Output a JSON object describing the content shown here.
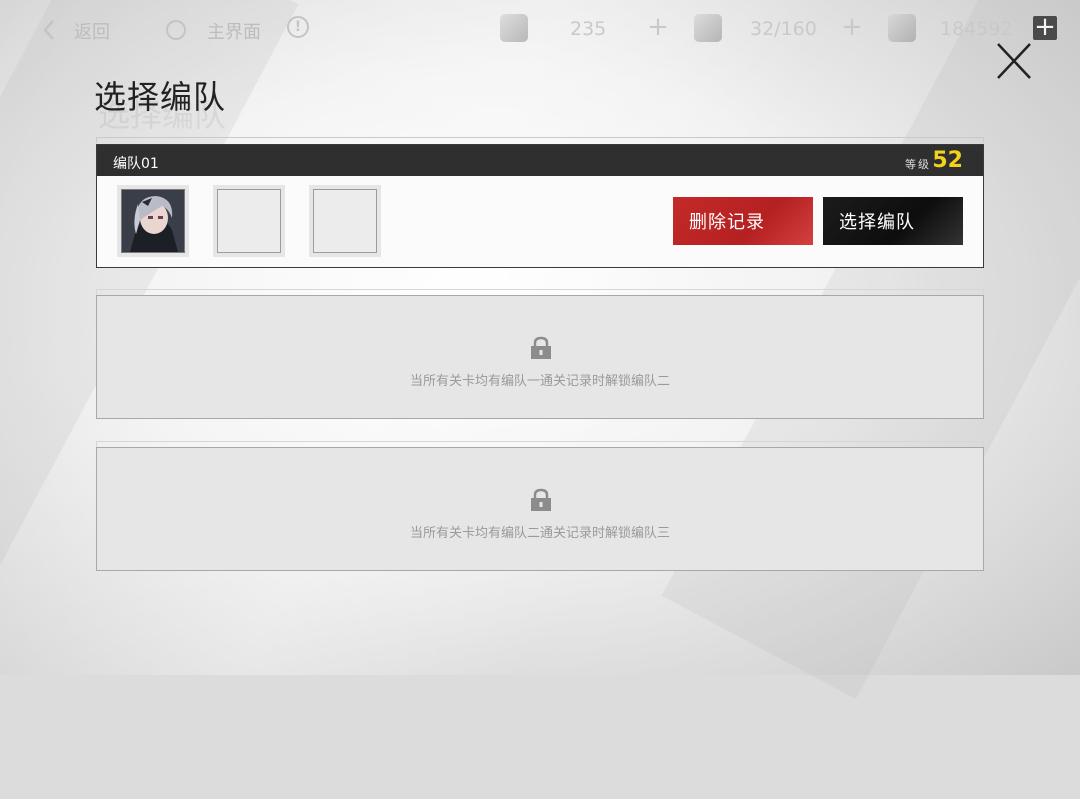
{
  "topbar": {
    "back_label": "返回",
    "home_label": "主界面",
    "resources": [
      {
        "icon": "stamina-pen-icon",
        "value": "235"
      },
      {
        "icon": "ticket-icon",
        "value": "32/160"
      },
      {
        "icon": "coin-icon",
        "value": "184592"
      }
    ],
    "plus_symbol": "+"
  },
  "page": {
    "title": "选择编队"
  },
  "teams": {
    "team1": {
      "name": "编队01",
      "level_label": "等级",
      "level": "52",
      "delete_label": "删除记录",
      "select_label": "选择编队"
    },
    "team2": {
      "unlock_text": "当所有关卡均有编队一通关记录时解锁编队二"
    },
    "team3": {
      "unlock_text": "当所有关卡均有编队二通关记录时解锁编队三"
    }
  },
  "colors": {
    "delete_button": "#c42a2a",
    "select_button": "#111111",
    "level_value": "#f2d21a",
    "header_bar": "#2f2f2f"
  }
}
